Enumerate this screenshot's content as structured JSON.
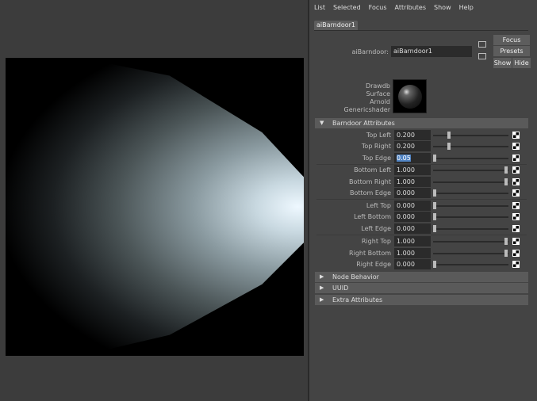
{
  "menu": [
    "List",
    "Selected",
    "Focus",
    "Attributes",
    "Show",
    "Help"
  ],
  "tab": "aiBarndoor1",
  "node": {
    "label": "aiBarndoor:",
    "value": "aiBarndoor1"
  },
  "buttons": {
    "focus": "Focus",
    "presets": "Presets",
    "show": "Show",
    "hide": "Hide"
  },
  "swatch_label": [
    "Drawdb",
    "Surface",
    "Arnold",
    "Genericshader"
  ],
  "section_title": "Barndoor Attributes",
  "attributes": [
    {
      "label": "Top Left",
      "value": "0.200",
      "fraction": 0.2
    },
    {
      "label": "Top Right",
      "value": "0.200",
      "fraction": 0.2
    },
    {
      "label": "Top Edge",
      "value": "0.05",
      "fraction": 0.0
    },
    {
      "label": "Bottom Left",
      "value": "1.000",
      "fraction": 1
    },
    {
      "label": "Bottom Right",
      "value": "1.000",
      "fraction": 1
    },
    {
      "label": "Bottom Edge",
      "value": "0.000",
      "fraction": 0
    },
    {
      "label": "Left Top",
      "value": "0.000",
      "fraction": 0
    },
    {
      "label": "Left Bottom",
      "value": "0.000",
      "fraction": 0
    },
    {
      "label": "Left Edge",
      "value": "0.000",
      "fraction": 0
    },
    {
      "label": "Right Top",
      "value": "1.000",
      "fraction": 1
    },
    {
      "label": "Right Bottom",
      "value": "1.000",
      "fraction": 1
    },
    {
      "label": "Right Edge",
      "value": "0.000",
      "fraction": 0
    }
  ],
  "collapsed_sections": [
    "Node Behavior",
    "UUID",
    "Extra Attributes"
  ]
}
